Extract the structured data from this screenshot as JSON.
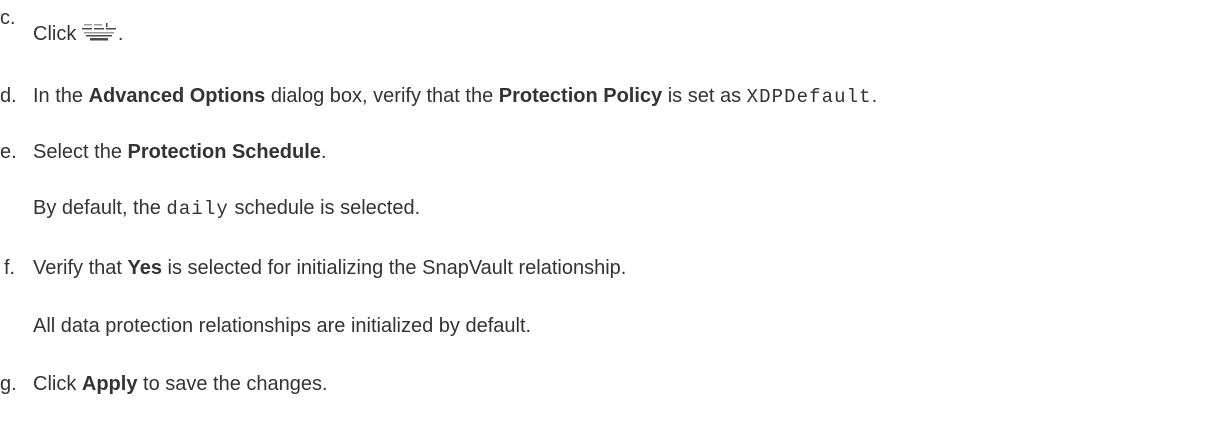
{
  "steps": [
    {
      "marker": "c.",
      "parts": {
        "t1": "Click",
        "t2": "."
      },
      "icon": "advanced-options-icon"
    },
    {
      "marker": "d.",
      "parts": {
        "t1": "In the ",
        "b1": "Advanced Options",
        "t2": " dialog box, verify that the ",
        "b2": "Protection Policy",
        "t3": " is set as ",
        "code": "XDPDefault",
        "t4": "."
      }
    },
    {
      "marker": "e.",
      "parts": {
        "t1": "Select the ",
        "b1": "Protection Schedule",
        "t2": "."
      },
      "note": {
        "t1": "By default, the ",
        "code": "daily",
        "t2": " schedule is selected."
      }
    },
    {
      "marker": "f.",
      "parts": {
        "t1": "Verify that ",
        "b1": "Yes",
        "t2": " is selected for initializing the SnapVault relationship."
      },
      "note": {
        "t1": "All data protection relationships are initialized by default."
      }
    },
    {
      "marker": "g.",
      "parts": {
        "t1": "Click ",
        "b1": "Apply",
        "t2": " to save the changes."
      }
    }
  ],
  "colors": {
    "text": "#333333",
    "icon_dark": "#4a4a4a",
    "icon_light": "#9a9a9a"
  }
}
